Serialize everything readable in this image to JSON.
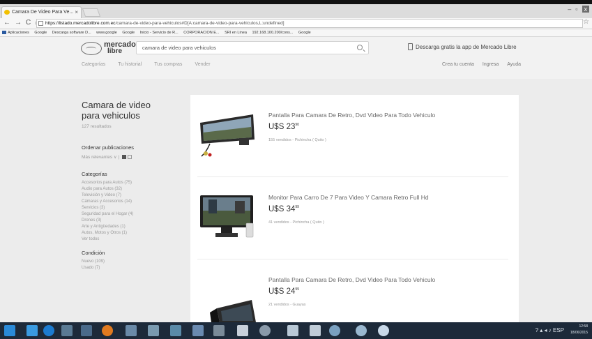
{
  "browser": {
    "tab_title": "Camara De Video Para Ve...",
    "tab_close": "×",
    "window_controls": [
      "–",
      "▫",
      "x"
    ],
    "url_host": "https://listado.mercadolibre.com.ec",
    "url_path": "/camara-de-video-para-vehiculos#D[A:camara-de-video-para-vehiculos,L:undefined]",
    "bookmarks": [
      "Aplicaciones",
      "Google",
      "Descarga software D...",
      "www.google",
      "Google",
      "Inicio - Servicio de R...",
      "CORPORACION E...",
      "SRI en Linea",
      "192.168.100.200/cons...",
      "Google"
    ]
  },
  "header": {
    "logo_line1": "mercado",
    "logo_line2": "libre",
    "search_value": "camara de video para vehiculos",
    "app_download": "Descarga gratis la app de Mercado Libre",
    "nav_left": [
      "Categorías",
      "Tu historial",
      "Tus compras",
      "Vender"
    ],
    "nav_right": [
      "Crea tu cuenta",
      "Ingresa",
      "Ayuda"
    ]
  },
  "sidebar": {
    "title": "Camara de video para vehiculos",
    "result_count": "127 resultados",
    "sort_heading": "Ordenar publicaciones",
    "sort_value": "Más relevantes ∨ |",
    "categories_heading": "Categorías",
    "categories": [
      "Accesorios para Autos (75)",
      "Audio para Autos (32)",
      "Televisión y Video (7)",
      "Cámaras y Accesorios (14)",
      "Servicios (3)",
      "Seguridad para el Hogar (4)",
      "Drones (3)",
      "Arte y Antigüedades (1)",
      "Autos, Motos y Otros (1)",
      "Ver todos"
    ],
    "condition_heading": "Condición",
    "conditions": [
      "Nuevo (109)",
      "Usado (7)"
    ]
  },
  "results": [
    {
      "title": "Pantalla Para Camara De Retro, Dvd Video Para Todo Vehiculo",
      "price_main": "U$S 23",
      "price_cents": "90",
      "meta": "155 vendidos - Pichincha ( Quito )"
    },
    {
      "title": "Monitor Para Carro De 7 Para Video Y Camara Retro Full Hd",
      "price_main": "U$S 34",
      "price_cents": "99",
      "meta": "41 vendidos - Pichincha ( Quito )"
    },
    {
      "title": "Pantalla Para Camara De Retro, Dvd Video Para Todo Vehiculo",
      "price_main": "U$S 24",
      "price_cents": "99",
      "meta": "21 vendidos - Guayas"
    }
  ],
  "taskbar": {
    "time": "12:58",
    "date": "18/06/2015",
    "lang": "ESP"
  }
}
